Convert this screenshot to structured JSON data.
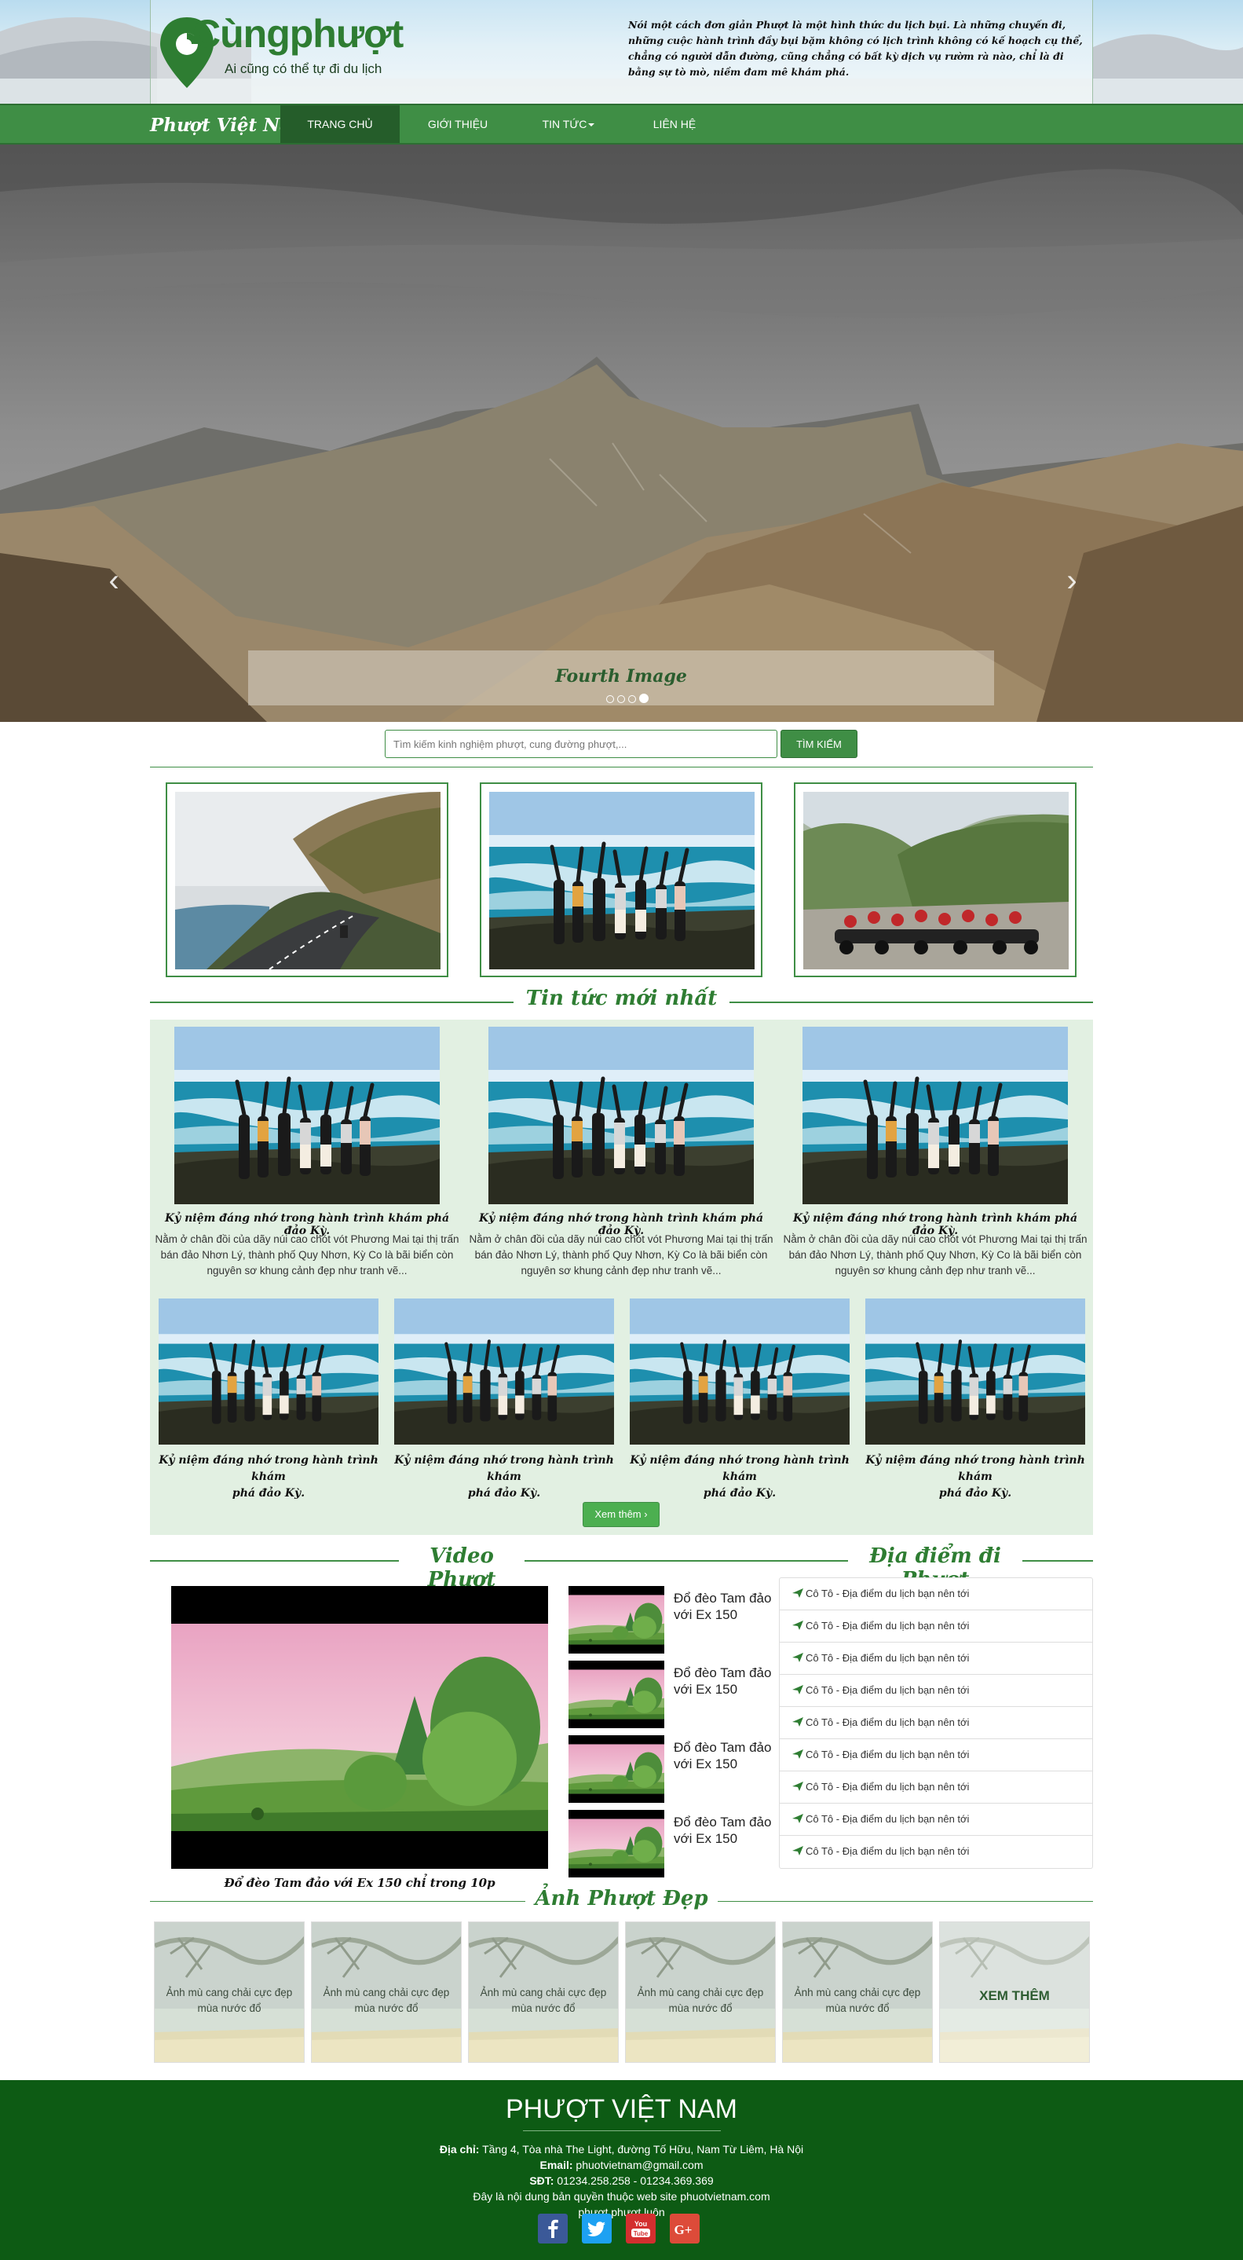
{
  "header": {
    "logo_main": "Cùngphượt",
    "logo_sub": "Ai cũng có thể tự đi du lịch",
    "quote": "Nói một cách đơn giản Phượt là một hình thức du lịch bụi. Là những chuyến đi, những cuộc hành trình đầy bụi bặm không có lịch trình không có kế hoạch cụ thể, chẳng có người dẫn đường, cũng chẳng có bất kỳ dịch vụ rườm rà nào, chỉ là đi bằng sự tò mò, niềm đam mê khám phá."
  },
  "nav": {
    "brand": "Phượt Việt Nam",
    "items": [
      {
        "label": "TRANG CHỦ",
        "active": true
      },
      {
        "label": "GIỚI THIỆU",
        "active": false
      },
      {
        "label": "TIN TỨC",
        "active": false
      },
      {
        "label": "LIÊN HỆ",
        "active": false
      }
    ]
  },
  "carousel": {
    "caption": "Fourth Image",
    "prev_icon": "‹",
    "next_icon": "›",
    "slide_count": 4,
    "active_index": 3
  },
  "search": {
    "placeholder": "Tìm kiếm kinh nghiệm phượt, cung đường phượt,...",
    "button": "TÌM KIẾM"
  },
  "sections": {
    "news": "Tin tức mới nhất",
    "video": "Video Phượt",
    "locations": "Địa điểm đi Phượt",
    "photos": "Ảnh Phượt Đẹp"
  },
  "news": {
    "title": "Kỷ niệm đáng nhớ trong hành trình khám phá đảo Kỳ.",
    "title_sm_1": "Kỷ niệm đáng nhớ trong hành trình khám",
    "title_sm_2": "phá đảo Kỳ.",
    "desc": "Nằm ở chân đồi của dãy núi cao chót vót Phương Mai tại thị trấn bán đảo Nhơn Lý, thành phố Quy Nhơn, Kỳ Co là bãi biển còn nguyên sơ khung cảnh đẹp như tranh vẽ...",
    "more_button": "Xem thêm"
  },
  "video": {
    "caption": "Đổ đèo Tam đảo với Ex 150 chỉ trong 10p",
    "thumb_label": "Đổ đèo Tam đảo với Ex 150"
  },
  "locations": {
    "item": "Cô Tô - Địa điểm du lịch bạn nên tới",
    "count": 9
  },
  "photos": {
    "caption": "Ảnh mù cang chải cực đẹp mùa nước đổ",
    "more": "XEM THÊM"
  },
  "footer": {
    "title": "PHƯỢT VIỆT NAM",
    "address_label": "Địa chỉ:",
    "address": "Tầng 4, Tòa nhà The Light, đường Tố Hữu, Nam Từ Liêm, Hà Nội",
    "email_label": "Email:",
    "email": "phuotvietnam@gmail.com",
    "phone_label": "SĐT:",
    "phone": "01234.258.258 - 01234.369.369",
    "copyright": "Đây là nội dung bản quyền thuộc web site phuotvietnam.com",
    "tagline": "phượt  phượt luôn",
    "social": [
      "facebook-icon",
      "twitter-icon",
      "youtube-icon",
      "google-plus-icon"
    ]
  },
  "colors": {
    "brand_green": "#3f8e45",
    "dark_green": "#0d5b14",
    "news_bg": "#e2f0e2"
  }
}
